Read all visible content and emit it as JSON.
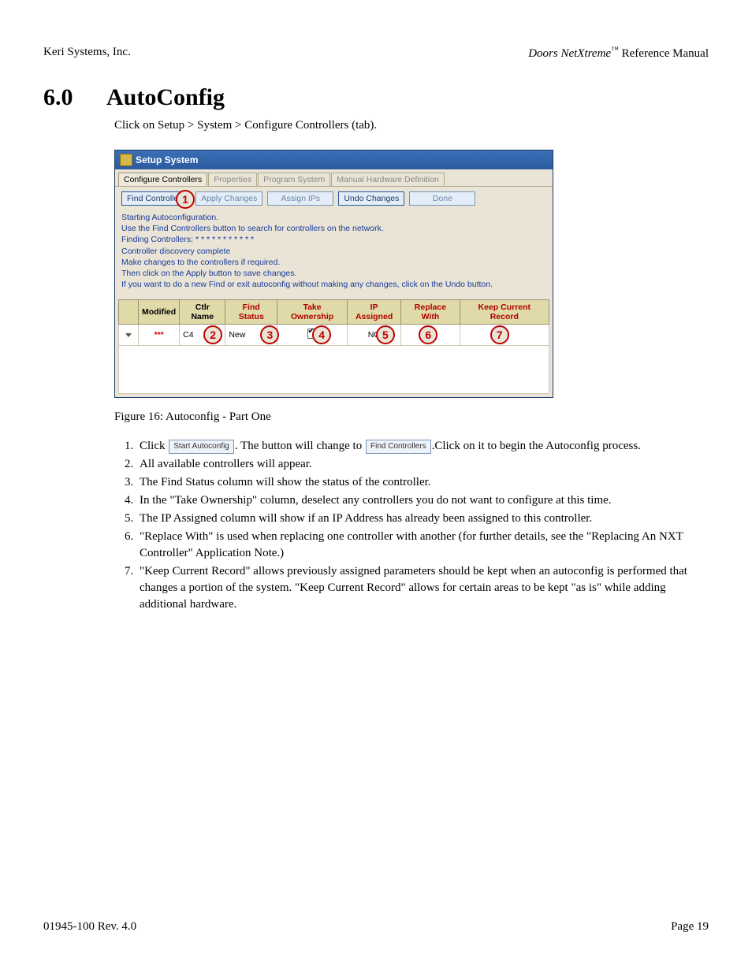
{
  "header": {
    "left": "Keri Systems, Inc.",
    "right_product": "Doors NetXtreme",
    "right_tm": "™",
    "right_suffix": " Reference Manual"
  },
  "title": {
    "num": "6.0",
    "text": "AutoConfig"
  },
  "breadcrumb": "Click on Setup > System > Configure Controllers (tab).",
  "window": {
    "title": "Setup System",
    "tabs": [
      "Configure Controllers",
      "Properties",
      "Program System",
      "Manual Hardware Definition"
    ],
    "active_tab": 0,
    "buttons": [
      "Find Controllers",
      "Apply Changes",
      "Assign IPs",
      "Undo Changes",
      "Done"
    ],
    "messages": [
      "Starting Autoconfiguration.",
      "Use the Find Controllers button to search for controllers on the network.",
      "Finding Controllers: * * * * * * * * * * *",
      "Controller discovery complete",
      "Make changes to the controllers if required.",
      "Then click on the Apply button to save changes.",
      "If you want to do a new Find or exit autoconfig without making any changes, click on the Undo button."
    ],
    "columns": [
      "Modified",
      "Ctlr Name",
      "Find Status",
      "Take Ownership",
      "IP Assigned",
      "Replace With",
      "Keep Current Record"
    ],
    "row": {
      "modified": "***",
      "ctlr_name": "C4",
      "find_status": "New",
      "take_ownership": true,
      "ip_assigned": "NO",
      "replace_with": "",
      "keep_current_record": ""
    },
    "callouts": [
      "1",
      "2",
      "3",
      "4",
      "5",
      "6",
      "7"
    ]
  },
  "caption": "Figure 16: Autoconfig - Part One",
  "inline_buttons": {
    "start": "Start Autoconfig",
    "find": "Find Controllers"
  },
  "steps": [
    {
      "pre": "Click ",
      "btn": "start",
      "mid": ". The button will change to ",
      "btn2": "find",
      "post": ".Click on it to begin the Autoconfig process."
    },
    {
      "text": "All available controllers will appear."
    },
    {
      "text": "The Find Status column will show the status of the controller."
    },
    {
      "text": "In the \"Take Ownership\" column, deselect any controllers you do not want to configure at this time."
    },
    {
      "text": "The IP Assigned column will show if an IP Address has already been assigned to this controller."
    },
    {
      "text": "\"Replace With\" is used when replacing one controller with another (for further details, see the \"Replacing An NXT Controller\" Application Note.)"
    },
    {
      "text": "\"Keep Current Record\" allows previously assigned parameters should be kept when an autoconfig is performed that changes a portion of the system. \"Keep Current Record\" allows for certain areas to be kept \"as is\" while adding additional hardware."
    }
  ],
  "footer": {
    "left": "01945-100  Rev. 4.0",
    "right": "Page 19"
  }
}
